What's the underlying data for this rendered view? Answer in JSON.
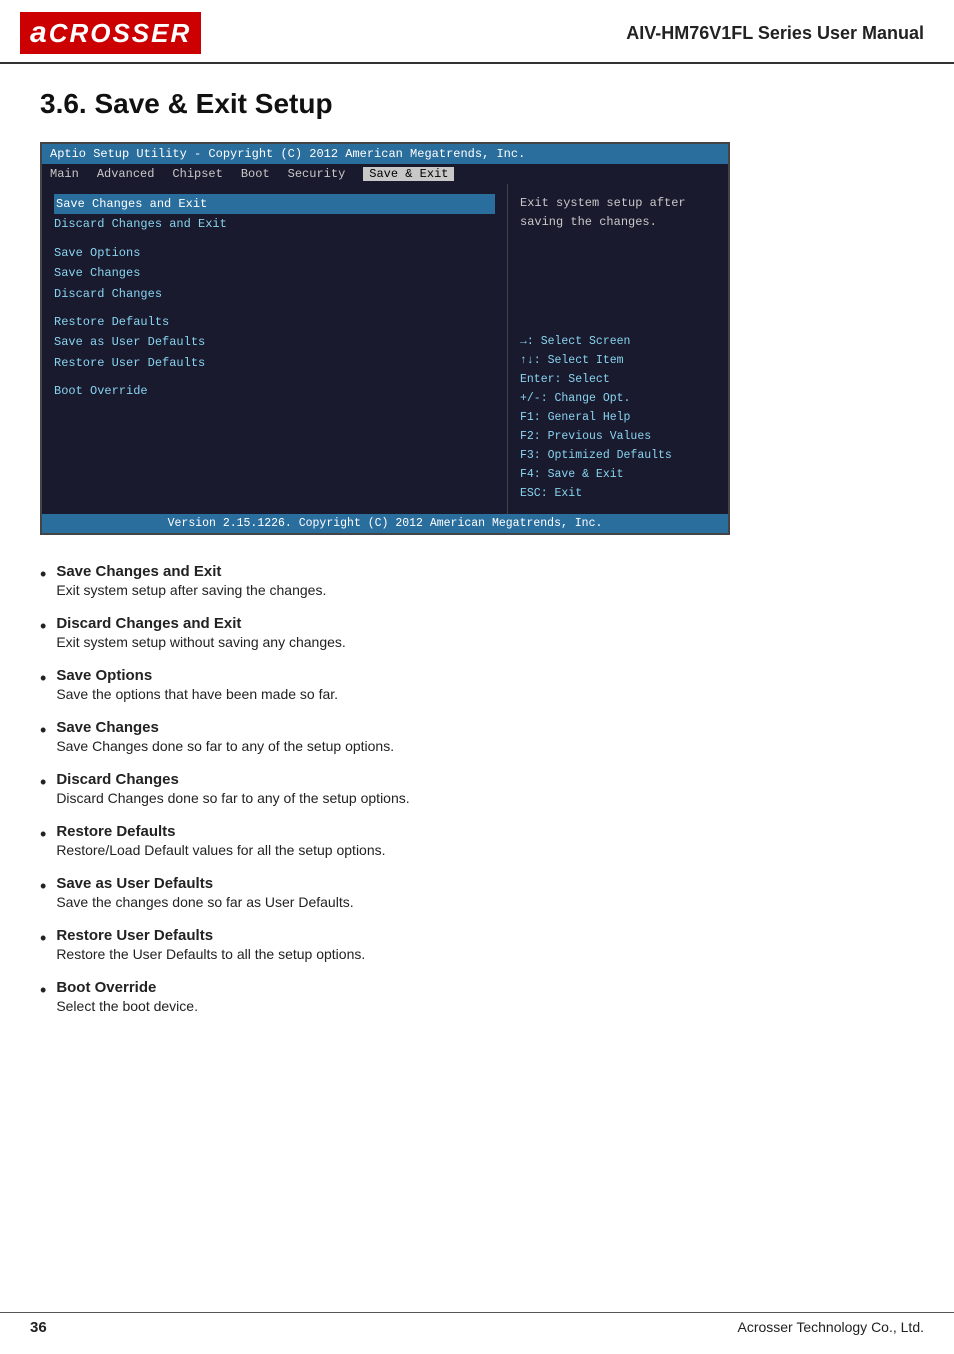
{
  "header": {
    "logo_letter": "a",
    "logo_brand": "CROSSER",
    "title": "AIV-HM76V1FL Series User Manual"
  },
  "section": {
    "number": "3.6.",
    "title": "Save & Exit Setup"
  },
  "bios": {
    "topbar": "Aptio Setup Utility - Copyright (C) 2012 American Megatrends, Inc.",
    "menu": {
      "items": [
        "Main",
        "Advanced",
        "Chipset",
        "Boot",
        "Security",
        "Save & Exit"
      ],
      "active": "Save & Exit"
    },
    "left_items": [
      {
        "label": "Save Changes and Exit",
        "highlight": true
      },
      {
        "label": "Discard Changes and Exit",
        "highlight": false
      },
      {
        "label": "",
        "spacer": true
      },
      {
        "label": "Save Options",
        "highlight": false
      },
      {
        "label": "Save Changes",
        "highlight": false
      },
      {
        "label": "Discard Changes",
        "highlight": false
      },
      {
        "label": "",
        "spacer": true
      },
      {
        "label": "Restore Defaults",
        "highlight": false
      },
      {
        "label": "Save as User Defaults",
        "highlight": false
      },
      {
        "label": "Restore User Defaults",
        "highlight": false
      },
      {
        "label": "",
        "spacer": true
      },
      {
        "label": "Boot Override",
        "highlight": false
      }
    ],
    "help_text": "Exit system setup after\nsaving the changes.",
    "nav_text": "→: Select Screen\n↑↓: Select Item\nEnter: Select\n+/-: Change Opt.\nF1: General Help\nF2: Previous Values\nF3: Optimized Defaults\nF4: Save & Exit\nESC: Exit",
    "footer": "Version 2.15.1226. Copyright (C) 2012 American Megatrends, Inc."
  },
  "bullets": [
    {
      "label": "Save Changes and Exit",
      "desc": "Exit system setup after saving the changes."
    },
    {
      "label": "Discard Changes and Exit",
      "desc": "Exit system setup without saving any changes."
    },
    {
      "label": "Save Options",
      "desc": "Save the options that have been made so far."
    },
    {
      "label": "Save Changes",
      "desc": "Save Changes done so far to any of the setup options."
    },
    {
      "label": "Discard Changes",
      "desc": "Discard Changes done so far to any of the setup options."
    },
    {
      "label": "Restore Defaults",
      "desc": "Restore/Load Default values for all the setup options."
    },
    {
      "label": "Save as User Defaults",
      "desc": "Save the changes done so far as User Defaults."
    },
    {
      "label": "Restore User Defaults",
      "desc": "Restore the User Defaults to all the setup options."
    },
    {
      "label": "Boot Override",
      "desc": "Select the boot device."
    }
  ],
  "footer": {
    "page_number": "36",
    "company": "Acrosser Technology Co., Ltd."
  }
}
